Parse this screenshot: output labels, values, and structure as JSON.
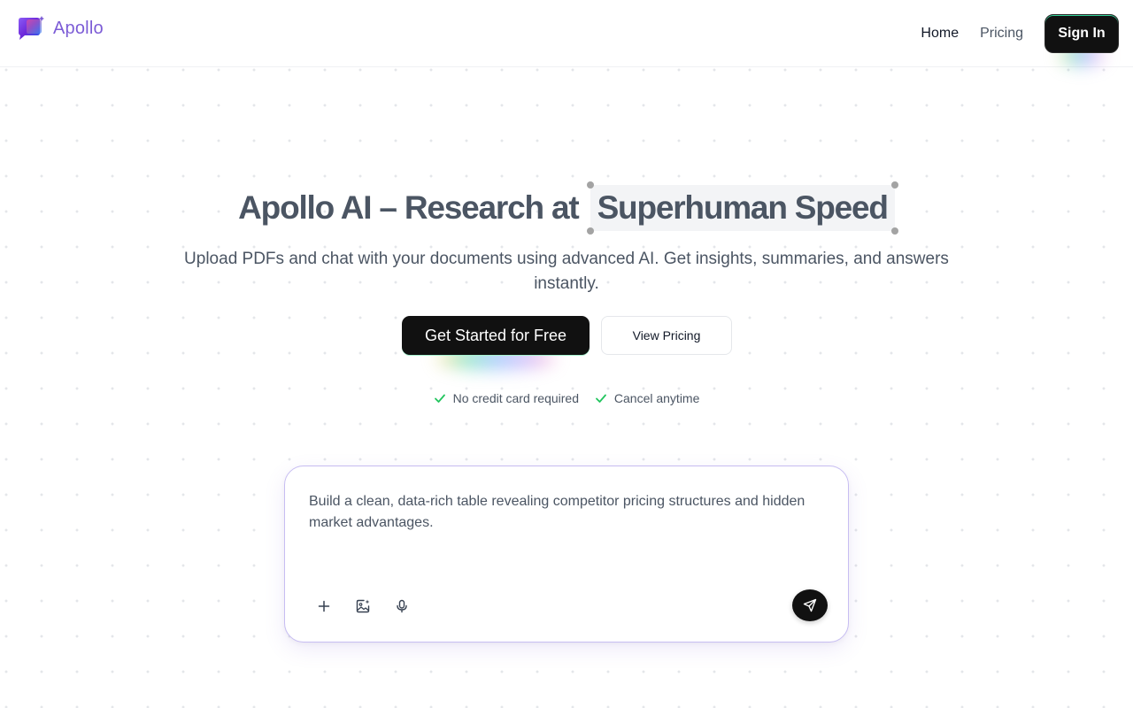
{
  "brand": {
    "name": "Apollo"
  },
  "nav": {
    "home": "Home",
    "pricing": "Pricing",
    "sign_in": "Sign In"
  },
  "hero": {
    "title_prefix": "Apollo AI – Research at",
    "title_highlight": "Superhuman Speed",
    "subtitle": "Upload PDFs and chat with your documents using advanced AI. Get insights, summaries, and answers instantly.",
    "cta_primary": "Get Started for Free",
    "cta_secondary": "View Pricing",
    "checks": [
      "No credit card required",
      "Cancel anytime"
    ]
  },
  "prompt": {
    "text": "Build a clean, data-rich table revealing competitor pricing structures and hidden market advantages.",
    "tools": [
      "plus-icon",
      "image-sparkle-icon",
      "microphone-icon"
    ],
    "send_icon": "send-icon"
  },
  "colors": {
    "accent": "#7c5cd6",
    "check": "#22c55e",
    "dark": "#111111"
  }
}
